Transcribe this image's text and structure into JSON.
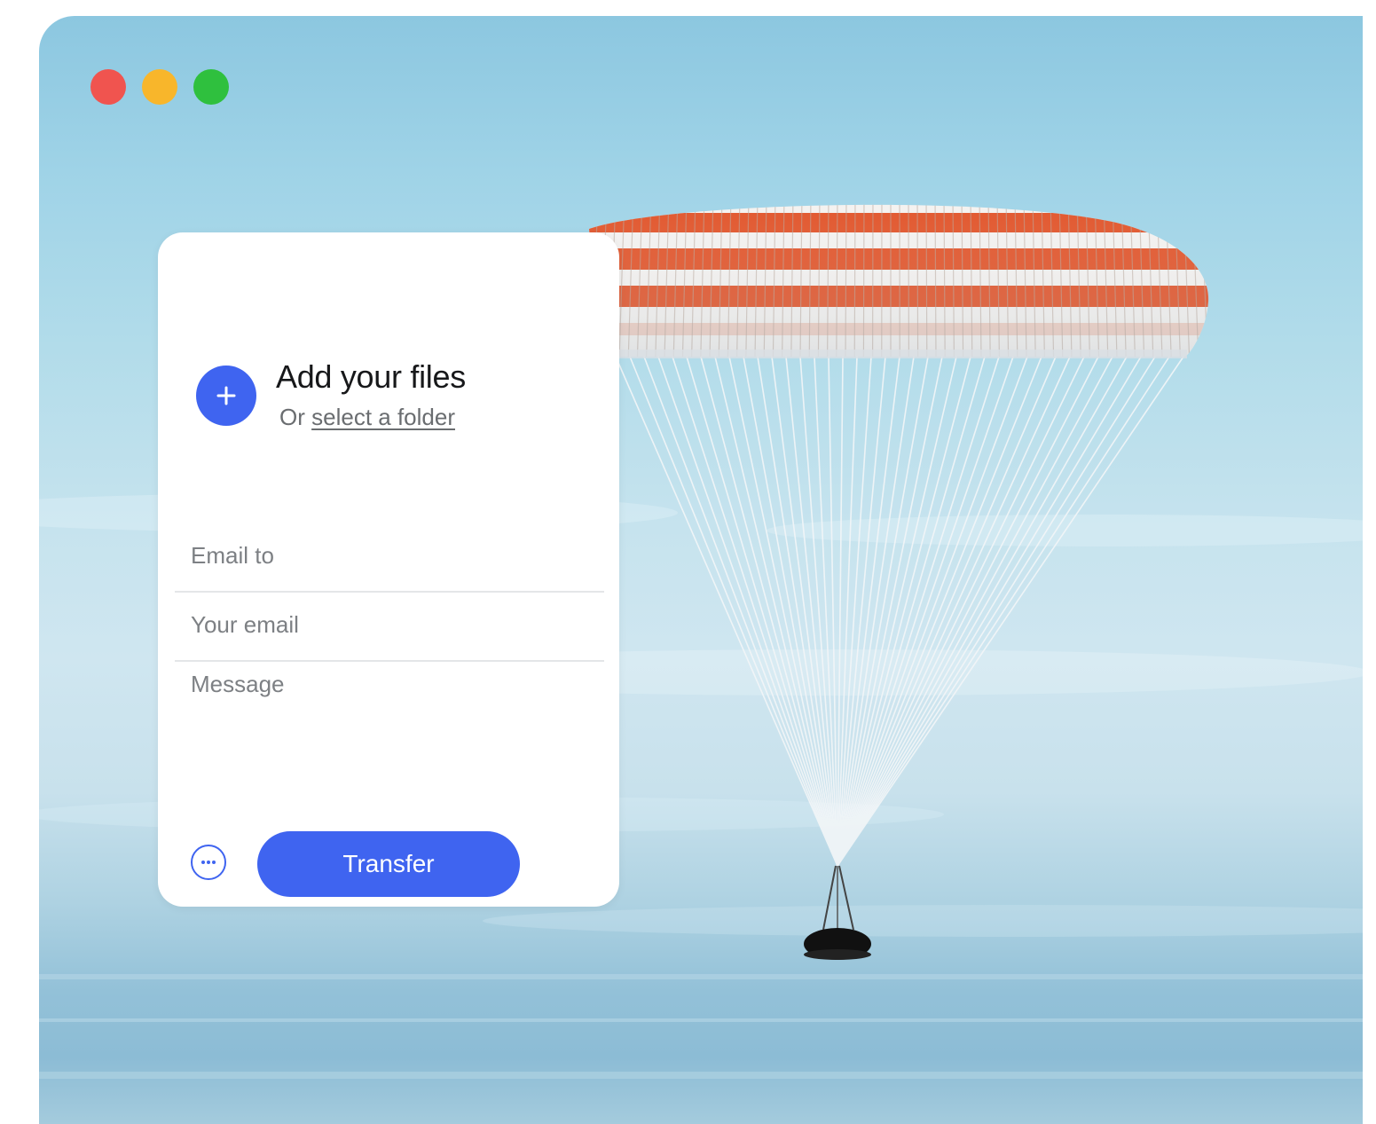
{
  "window": {
    "controls": [
      {
        "name": "close",
        "color": "#f0544f"
      },
      {
        "name": "minimize",
        "color": "#f8b62b"
      },
      {
        "name": "maximize",
        "color": "#2fc03e"
      }
    ]
  },
  "upload": {
    "title": "Add your files",
    "subtitle_prefix": "Or",
    "subtitle_link": "select a folder",
    "add_icon": "plus-icon"
  },
  "form": {
    "email_to_placeholder": "Email to",
    "your_email_placeholder": "Your email",
    "message_placeholder": "Message"
  },
  "actions": {
    "more_icon": "more-options-icon",
    "transfer_label": "Transfer"
  },
  "colors": {
    "accent": "#3f64f0",
    "canopy_stripe": "#e2552b"
  }
}
